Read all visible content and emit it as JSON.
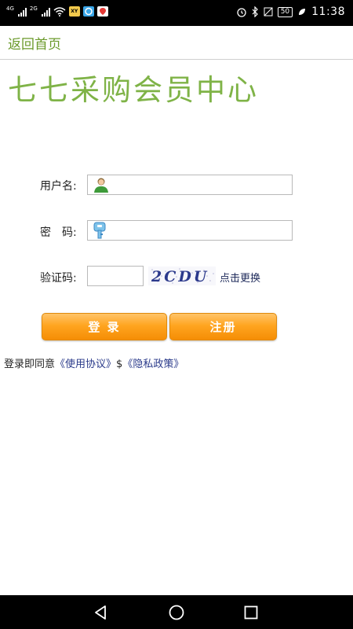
{
  "status_bar": {
    "net1": "4G",
    "net2": "2G",
    "app_badge": "XY",
    "battery": "50",
    "time": "11:38"
  },
  "header": {
    "back_label": "返回首页"
  },
  "title": "七七采购会员中心",
  "form": {
    "username_label": "用户名:",
    "username_value": "",
    "password_label": "密　码:",
    "password_value": "",
    "captcha_label": "验证码:",
    "captcha_value": "",
    "captcha_text": "2CDU",
    "refresh_label": "点击更换"
  },
  "buttons": {
    "login": "登 录",
    "register": "注册"
  },
  "agreement": {
    "prefix": "登录即同意",
    "terms": "《使用协议》",
    "separator": "$",
    "privacy": "《隐私政策》"
  },
  "colors": {
    "accent_green": "#7fb347",
    "link_green": "#6b9a2b",
    "button_orange": "#ffa520",
    "link_blue": "#2a3a8a"
  }
}
